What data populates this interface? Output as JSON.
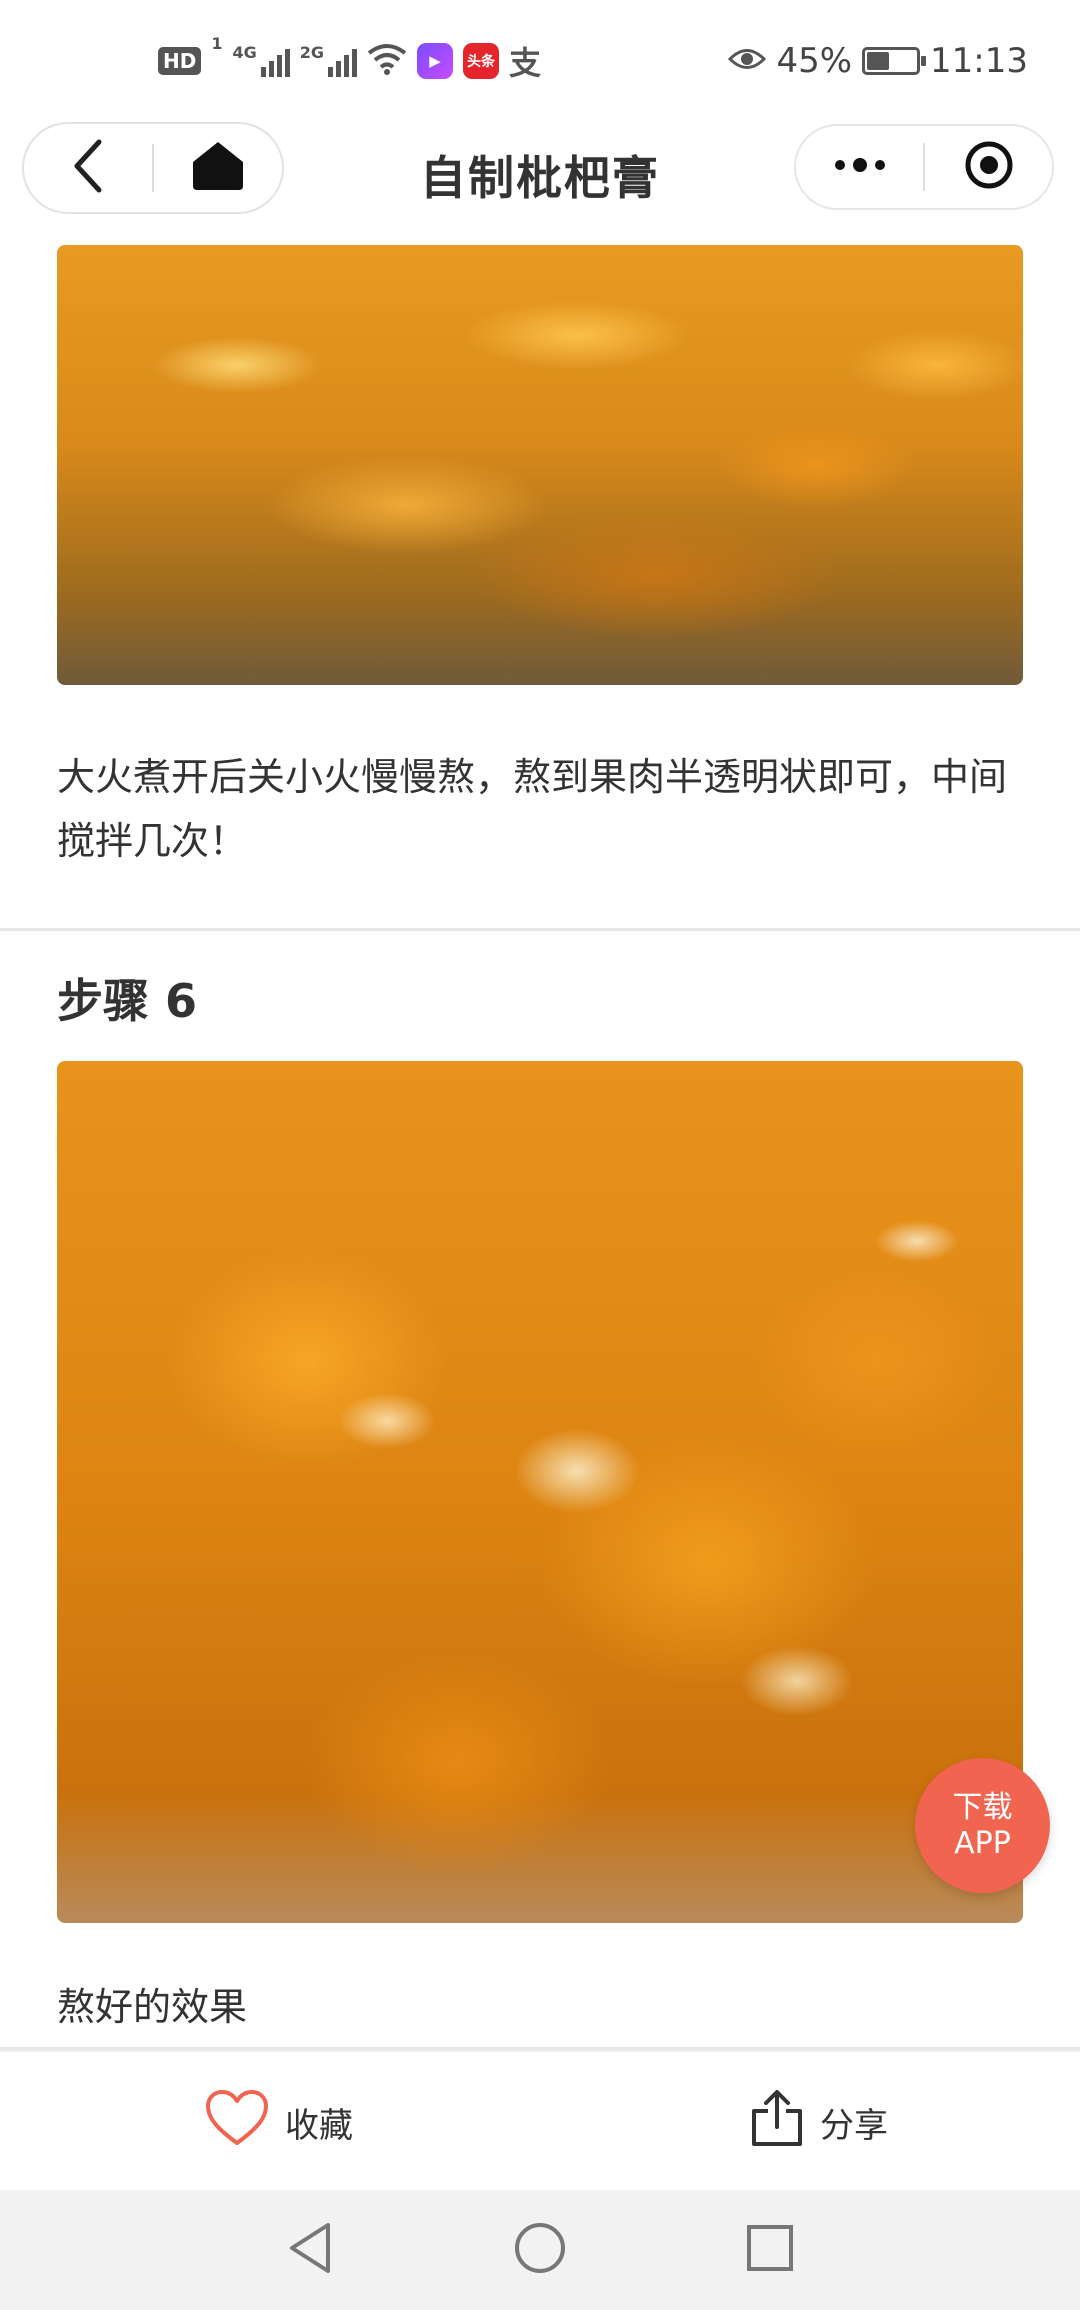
{
  "status_bar": {
    "hd_label": "HD",
    "sim_label": "1",
    "signal_1_label": "4G",
    "signal_2_label": "2G",
    "app_1_label": "▶",
    "app_2_label": "头条",
    "app_3_label": "支",
    "battery_percent": "45%",
    "battery_level": 0.45,
    "time": "11:13"
  },
  "nav": {
    "title": "自制枇杷膏"
  },
  "content": {
    "step5_text": "大火煮开后关小火慢慢熬，熬到果肉半透明状即可，中间搅拌几次！",
    "step6_title": "步骤 6",
    "step6_text": "熬好的效果"
  },
  "fab": {
    "line1": "下载",
    "line2": "APP"
  },
  "bottom_bar": {
    "favorite_label": "收藏",
    "share_label": "分享"
  },
  "colors": {
    "accent": "#f06450",
    "heart": "#f06450"
  }
}
